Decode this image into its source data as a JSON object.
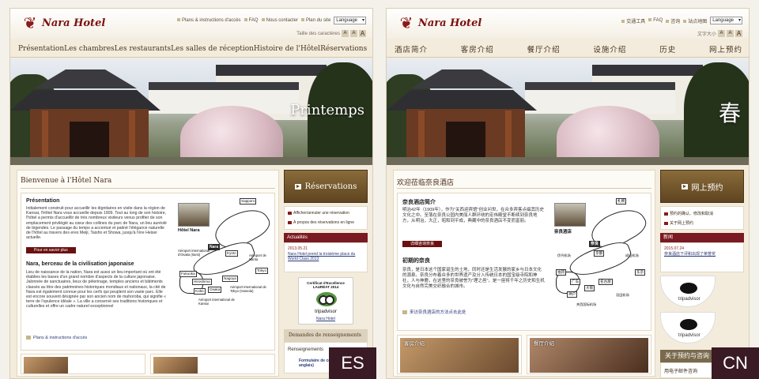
{
  "es": {
    "logo": "Nara Hotel",
    "toplinks": [
      "Plans & instructions d'accès",
      "FAQ",
      "Nous contacter",
      "Plan du site"
    ],
    "language": "Language",
    "fontsize_label": "Taille des caractères",
    "nav": [
      "Présentation",
      "Les chambres",
      "Les restaurants",
      "Les salles de réception",
      "Histoire de l'Hôtel",
      "Réservations"
    ],
    "hero_caption": "Printemps",
    "welcome_title": "Bienvenue à l'Hôtel Nara",
    "section1_title": "Présentation",
    "section1_text": "Initialement construit pour accueillir les dignitaires en visite dans la région de Kansai, l'Hôtel Nara vous accueille depuis 1909. Tout au long de son histoire, l'hôtel a permis d'accueillir de très nombreux visiteurs venus profiter de son emplacement privilégié au cœur des collines du parc de Nara, un lieu auréolé de légendes. Le passage du temps a accentué et patiné l'élégance naturelle de l'hôtel au travers des eres Meiji, Taisho et Showa, jusqu'à l'ère Heisei actuelle.",
    "more_button": "Pour en savoir plus",
    "section2_title": "Nara, berceau de la civilisation japonaise",
    "section2_text": "Lieu de naissance de la nation, Nara est aussi un lieu important où ont été établies les bases d'un grand nombre d'aspects de la culture japonaise. Jalonnée de sanctuaires, lieux de pèlerinage, temples anciens et bâtiments classés au titre des patrimoines historiques mondiaux et nationaux, la cité de Nara est également connue pour les cerfs qui peuplent son vaste parc. Elle est encore souvent désignée par son ancien nom de mahoroba, qui signifie « terre de l'opulence idéale ». La ville a conservé ses traditions historiques et culturelles et offre un cadre naturel exceptionnel",
    "plans_link": "Plans & instructions d'accès",
    "map": {
      "photo_label": "Hôtel Nara",
      "cities": [
        "Sapporo",
        "Nara",
        "Kyoto",
        "Fukuoka",
        "Kobe",
        "Osaka",
        "Nagoya",
        "Tokyo",
        "Hiroshima"
      ],
      "notes": [
        "Aéroport international d'Osaka (Itami)",
        "Aéroport de Narita",
        "Aéroport international de Tokyo (Haneda)",
        "Aéroport international de Kansai"
      ]
    },
    "reservations_button": "Réservations",
    "side_links": [
      "Afficher/annuler une réservation",
      "À propos des réservations en ligne"
    ],
    "news_header": "Actualités",
    "news_date": "2013.05.21",
    "news_text": "Nara Hotel prend la troisième place du World Class 2013",
    "ta": {
      "title": "Certificat d'Excellence",
      "year": "LAURÉAT 2014",
      "word": "tripadvisor",
      "hotel": "Nara Hotel"
    },
    "request_header": "Demandes de renseignements",
    "request_label": "Renseignements",
    "form_label": "Formulaire de contact (en anglais)",
    "tag": "ES"
  },
  "cn": {
    "logo": "Nara Hotel",
    "toplinks": [
      "交通工具",
      "FAQ",
      "咨询",
      "站点地图"
    ],
    "language": "Language",
    "fontsize_label": "文字大小",
    "nav": [
      "酒店简介",
      "客房介绍",
      "餐厅介绍",
      "设施介绍",
      "历史",
      "网上预约"
    ],
    "hero_caption": "春",
    "welcome_title": "欢迎莅临奈良酒店",
    "section1_title": "奈良酒店简介",
    "section1_text": "明治42年（1909年），作为\"关西迎宾馆\"创业问世，在众多宾客点缀其历史文化之中。至落在奈良公园内美丽人群环绕的宏伟殿堂不断续到奈良地方，从明治，大正，昭和到平成，典藏中的奈良酒店不变而富丽。",
    "more_button": "详细咨询奈良",
    "section2_title": "初期的奈良",
    "section2_text": "奈良，是日本这个国家诞生的土地，同时还是生活发展的家乡与日本文化的源泉。奈良分布着众多的世界遗产及分入传统日本的国宝级寺院和神社，人与神鹿，在这里的奈良被誉为\"理之邑\"，是一座将千年之历史和生机文化与自然完美交织融合的城市。",
    "plans_link": "来访奈良酒店的方法点击此处",
    "map": {
      "photo_label": "奈良酒店",
      "cities": [
        "札幌",
        "奈良",
        "京都",
        "福冈",
        "神户",
        "大阪",
        "名古屋",
        "东京",
        "广岛"
      ],
      "notes": [
        "成田机场",
        "伊丹机场",
        "羽田机场",
        "关西国际机场"
      ]
    },
    "strip": [
      "客房介绍",
      "餐厅介绍"
    ],
    "reservations_button": "网上预约",
    "side_links": [
      "预约的确认、修改和取消",
      "关于网上预约"
    ],
    "news_header": "新闻",
    "news_date": "2015.07.24",
    "news_text": "奈良酒店下评和出现了荣誉奖",
    "ta_word": "tripadvisor",
    "request_header": "关于预约与咨询",
    "request_label": "用电子邮件咨询",
    "tag": "CN"
  }
}
